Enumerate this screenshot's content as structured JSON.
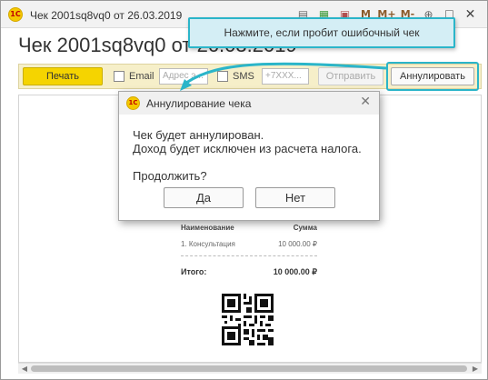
{
  "window": {
    "title": "Чек 2001sq8vq0 от 26.03.2019",
    "logo_text": "1С",
    "controls": [
      {
        "icon": "document-icon",
        "glyph": "▤"
      },
      {
        "icon": "table-icon",
        "glyph": "▦"
      },
      {
        "icon": "calendar-icon",
        "glyph": "▣"
      },
      {
        "icon": "memory-m-icon",
        "glyph": "M"
      },
      {
        "icon": "memory-plus-icon",
        "glyph": "M+"
      },
      {
        "icon": "memory-minus-icon",
        "glyph": "M-"
      },
      {
        "icon": "zoom-in-icon",
        "glyph": "⊕"
      },
      {
        "icon": "maximize-icon",
        "glyph": "☐"
      },
      {
        "icon": "close-icon",
        "glyph": "✕"
      }
    ]
  },
  "heading": "Чек 2001sq8vq0 от 26.03.2019",
  "toolbar": {
    "print_label": "Печать",
    "email_label": "Email",
    "email_placeholder": "Адрес э...",
    "sms_label": "SMS",
    "sms_placeholder": "+7XXX...",
    "send_label": "Отправить",
    "cancel_label": "Аннулировать"
  },
  "tooltip": {
    "text": "Нажмите, если пробит ошибочный чек"
  },
  "dialog": {
    "title": "Аннулирование чека",
    "message_line1": "Чек будет аннулирован.",
    "message_line2": "Доход будет исключен из расчета налога.",
    "prompt": "Продолжить?",
    "yes_label": "Да",
    "no_label": "Нет",
    "close_glyph": "✕"
  },
  "receipt": {
    "col_name": "Наименование",
    "col_sum": "Сумма",
    "item_name": "1.  Консультация",
    "item_amount": "10 000.00 ₽",
    "total_label": "Итого:",
    "total_amount": "10 000.00 ₽"
  },
  "colors": {
    "accent": "#2bb5c9",
    "tooltip_bg": "#d4eef5",
    "print_button": "#f5d400",
    "toolbar_bg": "#f6efc9"
  }
}
